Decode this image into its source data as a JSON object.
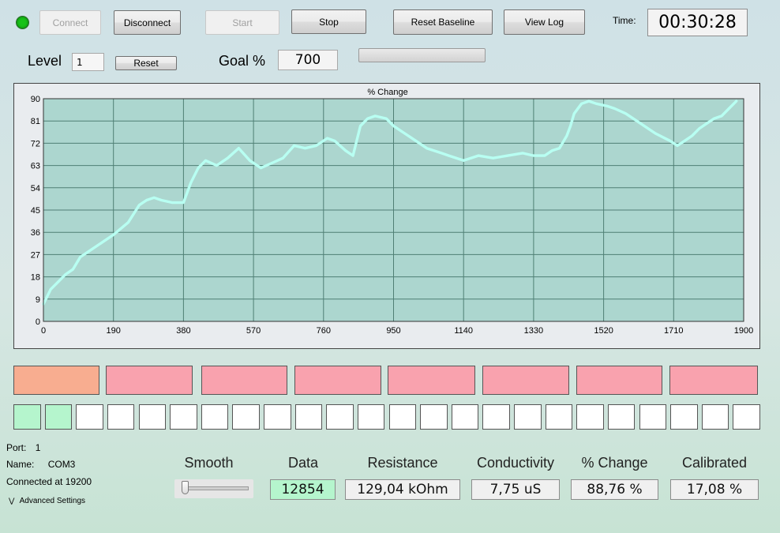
{
  "status_led_color": "#19c219",
  "toolbar": {
    "connect_label": "Connect",
    "disconnect_label": "Disconnect",
    "start_label": "Start",
    "stop_label": "Stop",
    "reset_baseline_label": "Reset Baseline",
    "view_log_label": "View Log",
    "time_label": "Time:",
    "time_value": "00:30:28"
  },
  "level": {
    "label": "Level",
    "value": "1",
    "reset_label": "Reset"
  },
  "goal": {
    "label": "Goal %",
    "value": "700",
    "progress": 0
  },
  "colors": {
    "plot_bg": "#acd6cf",
    "line": "#b8fff2",
    "grid": "#4f7f74",
    "zone_first": "#f8ad90",
    "zone_other": "#f9a2ae",
    "cell_on": "#b5f5cd",
    "data_bg": "#b5f5cd"
  },
  "chart_data": {
    "type": "line",
    "title": "% Change",
    "xlabel": "",
    "ylabel": "",
    "xlim": [
      0,
      1900
    ],
    "ylim": [
      0,
      90
    ],
    "xticks": [
      0,
      190,
      380,
      570,
      760,
      950,
      1140,
      1330,
      1520,
      1710,
      1900
    ],
    "yticks": [
      0,
      9,
      18,
      27,
      36,
      45,
      54,
      63,
      72,
      81,
      90
    ],
    "grid": true,
    "series": [
      {
        "x": [
          0,
          20,
          40,
          60,
          80,
          100,
          120,
          150,
          190,
          230,
          260,
          280,
          300,
          320,
          350,
          380,
          400,
          420,
          440,
          470,
          500,
          530,
          560,
          590,
          620,
          650,
          680,
          710,
          740,
          770,
          790,
          820,
          840,
          860,
          880,
          900,
          930,
          950,
          980,
          1000,
          1040,
          1080,
          1100,
          1140,
          1160,
          1180,
          1220,
          1260,
          1300,
          1330,
          1360,
          1380,
          1400,
          1420,
          1430,
          1440,
          1460,
          1480,
          1500,
          1530,
          1550,
          1580,
          1620,
          1660,
          1700,
          1720,
          1740,
          1760,
          1780,
          1800,
          1820,
          1840,
          1860,
          1880
        ],
        "y": [
          7,
          13,
          16,
          19,
          21,
          26,
          28,
          31,
          35,
          40,
          47,
          49,
          50,
          49,
          48,
          48,
          56,
          62,
          65,
          63,
          66,
          70,
          65,
          62,
          64,
          66,
          71,
          70,
          71,
          74,
          73,
          69,
          67,
          79,
          82,
          83,
          82,
          79,
          76,
          74,
          70,
          68,
          67,
          65,
          66,
          67,
          66,
          67,
          68,
          67,
          67,
          69,
          70,
          75,
          79,
          84,
          88,
          89,
          88,
          87,
          86,
          84,
          80,
          76,
          73,
          71,
          73,
          75,
          78,
          80,
          82,
          83,
          86,
          89
        ]
      }
    ]
  },
  "zones": [
    {
      "type": "first"
    },
    {
      "type": "other"
    },
    {
      "type": "other"
    },
    {
      "type": "other"
    },
    {
      "type": "other"
    },
    {
      "type": "other"
    },
    {
      "type": "other"
    },
    {
      "type": "other"
    }
  ],
  "level_cells": [
    true,
    true,
    false,
    false,
    false,
    false,
    false,
    false,
    false,
    false,
    false,
    false,
    false,
    false,
    false,
    false,
    false,
    false,
    false,
    false,
    false,
    false,
    false,
    false
  ],
  "connection": {
    "port_label": "Port:",
    "port_value": "1",
    "name_label": "Name:",
    "name_value": "COM3",
    "connected_text": "Connected at 19200",
    "advanced_label": "Advanced Settings"
  },
  "smooth": {
    "label": "Smooth",
    "value": 0
  },
  "stats": {
    "data_label": "Data",
    "data_value": "12854",
    "resistance_label": "Resistance",
    "resistance_value": "129,04 kOhm",
    "conductivity_label": "Conductivity",
    "conductivity_value": "7,75 uS",
    "pct_change_label": "% Change",
    "pct_change_value": "88,76 %",
    "calibrated_label": "Calibrated",
    "calibrated_value": "17,08 %"
  }
}
